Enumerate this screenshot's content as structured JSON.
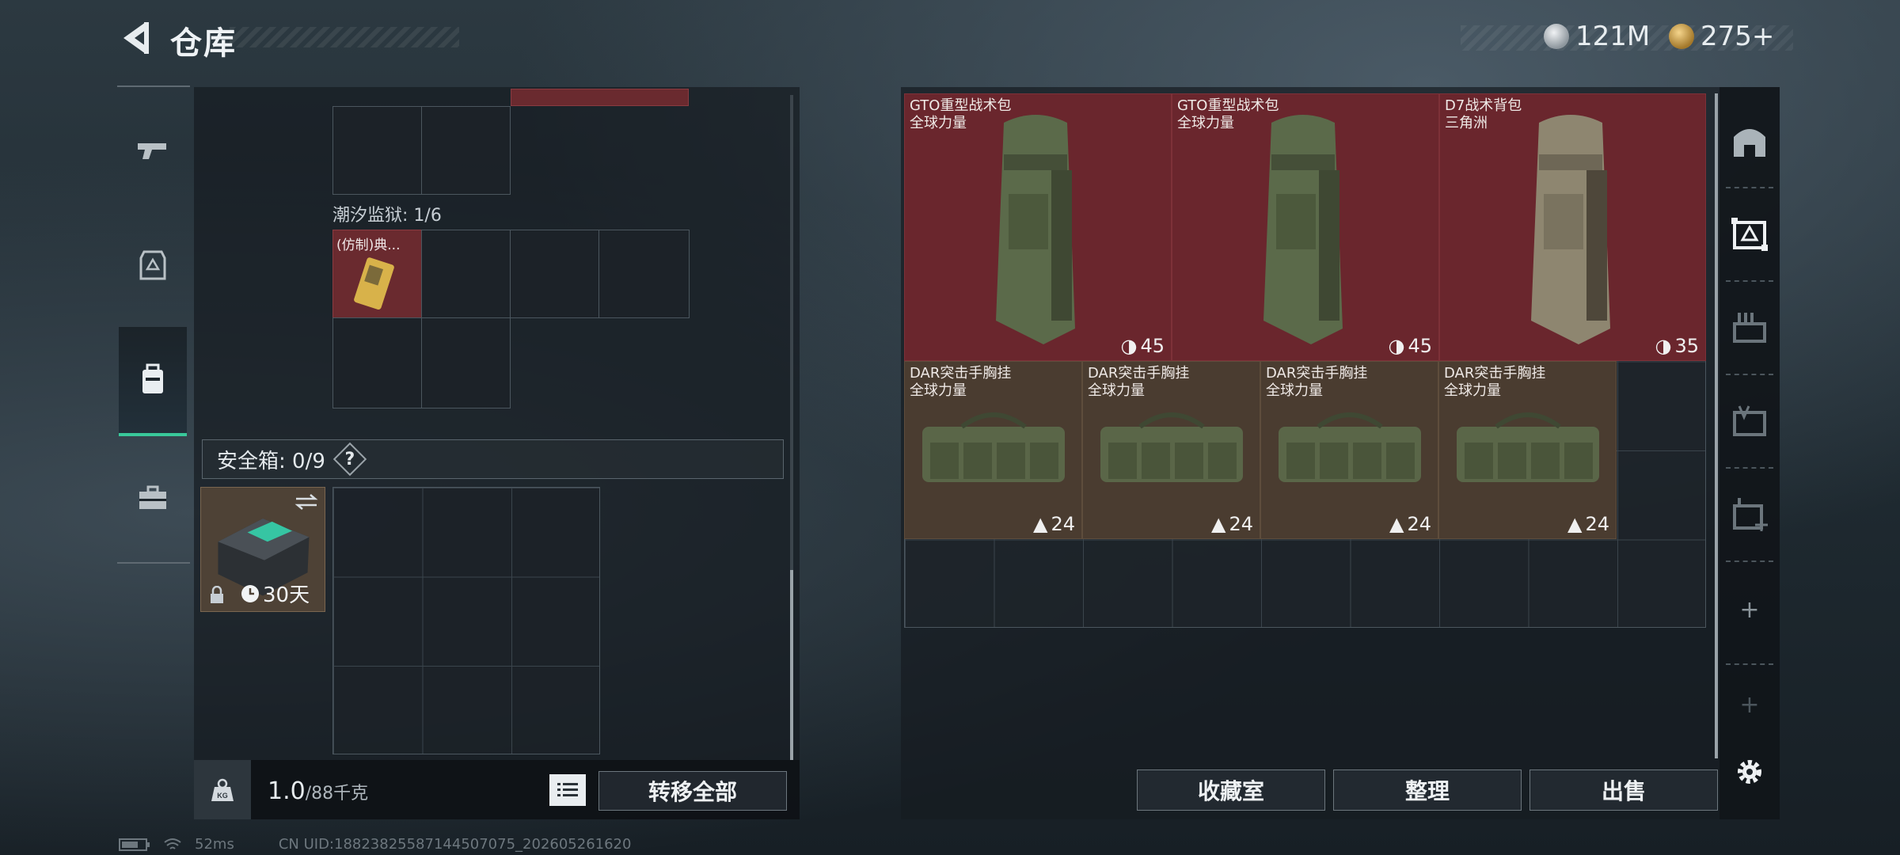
{
  "header": {
    "title": "仓库",
    "currencies": [
      {
        "icon": "silver-coin-icon",
        "value": "121M"
      },
      {
        "icon": "gold-coin-icon",
        "value": "275+"
      }
    ]
  },
  "left_nav": [
    {
      "name": "weapons",
      "icon": "pistol-icon",
      "active": false
    },
    {
      "name": "armor",
      "icon": "armor-vest-icon",
      "active": false
    },
    {
      "name": "backpacks",
      "icon": "backpack-icon",
      "active": true
    },
    {
      "name": "toolbox",
      "icon": "briefcase-icon",
      "active": false
    }
  ],
  "loadout": {
    "tide_prison_label": "潮汐监狱: 1/6",
    "tide_item_name": "(仿制)典...",
    "safebox_label": "安全箱: 0/9",
    "safebox_help": "?",
    "safebox_duration": "30天",
    "weight_value": "1.0",
    "weight_max": "/88千克",
    "transfer_all": "转移全部"
  },
  "stash": {
    "items": [
      {
        "name": "GTO重型战术包",
        "brand": "全球力量",
        "capacity": "45",
        "color": "red"
      },
      {
        "name": "GTO重型战术包",
        "brand": "全球力量",
        "capacity": "45",
        "color": "red"
      },
      {
        "name": "D7战术背包",
        "brand": "三角洲",
        "capacity": "35",
        "color": "red"
      },
      {
        "name": "DAR突击手胸挂",
        "brand": "全球力量",
        "capacity": "24",
        "color": "brown"
      },
      {
        "name": "DAR突击手胸挂",
        "brand": "全球力量",
        "capacity": "24",
        "color": "brown"
      },
      {
        "name": "DAR突击手胸挂",
        "brand": "全球力量",
        "capacity": "24",
        "color": "brown"
      },
      {
        "name": "DAR突击手胸挂",
        "brand": "全球力量",
        "capacity": "24",
        "color": "brown"
      }
    ],
    "buttons": {
      "collection": "收藏室",
      "organize": "整理",
      "sell": "出售"
    }
  },
  "side_tabs": [
    "stash-tab-icon",
    "tactical-case-icon",
    "ammo-case-icon",
    "vest-case-icon",
    "medical-case-icon",
    "add-tab-icon",
    "add-tab-icon",
    "settings-gear-icon"
  ],
  "status_bar": {
    "ping": "52ms",
    "uid": "CN UID:18823825587144507075_202605261620"
  },
  "colors": {
    "accent": "#39c89a",
    "rare_red": "#6a262d",
    "uncommon_brown": "#4a3c30"
  }
}
